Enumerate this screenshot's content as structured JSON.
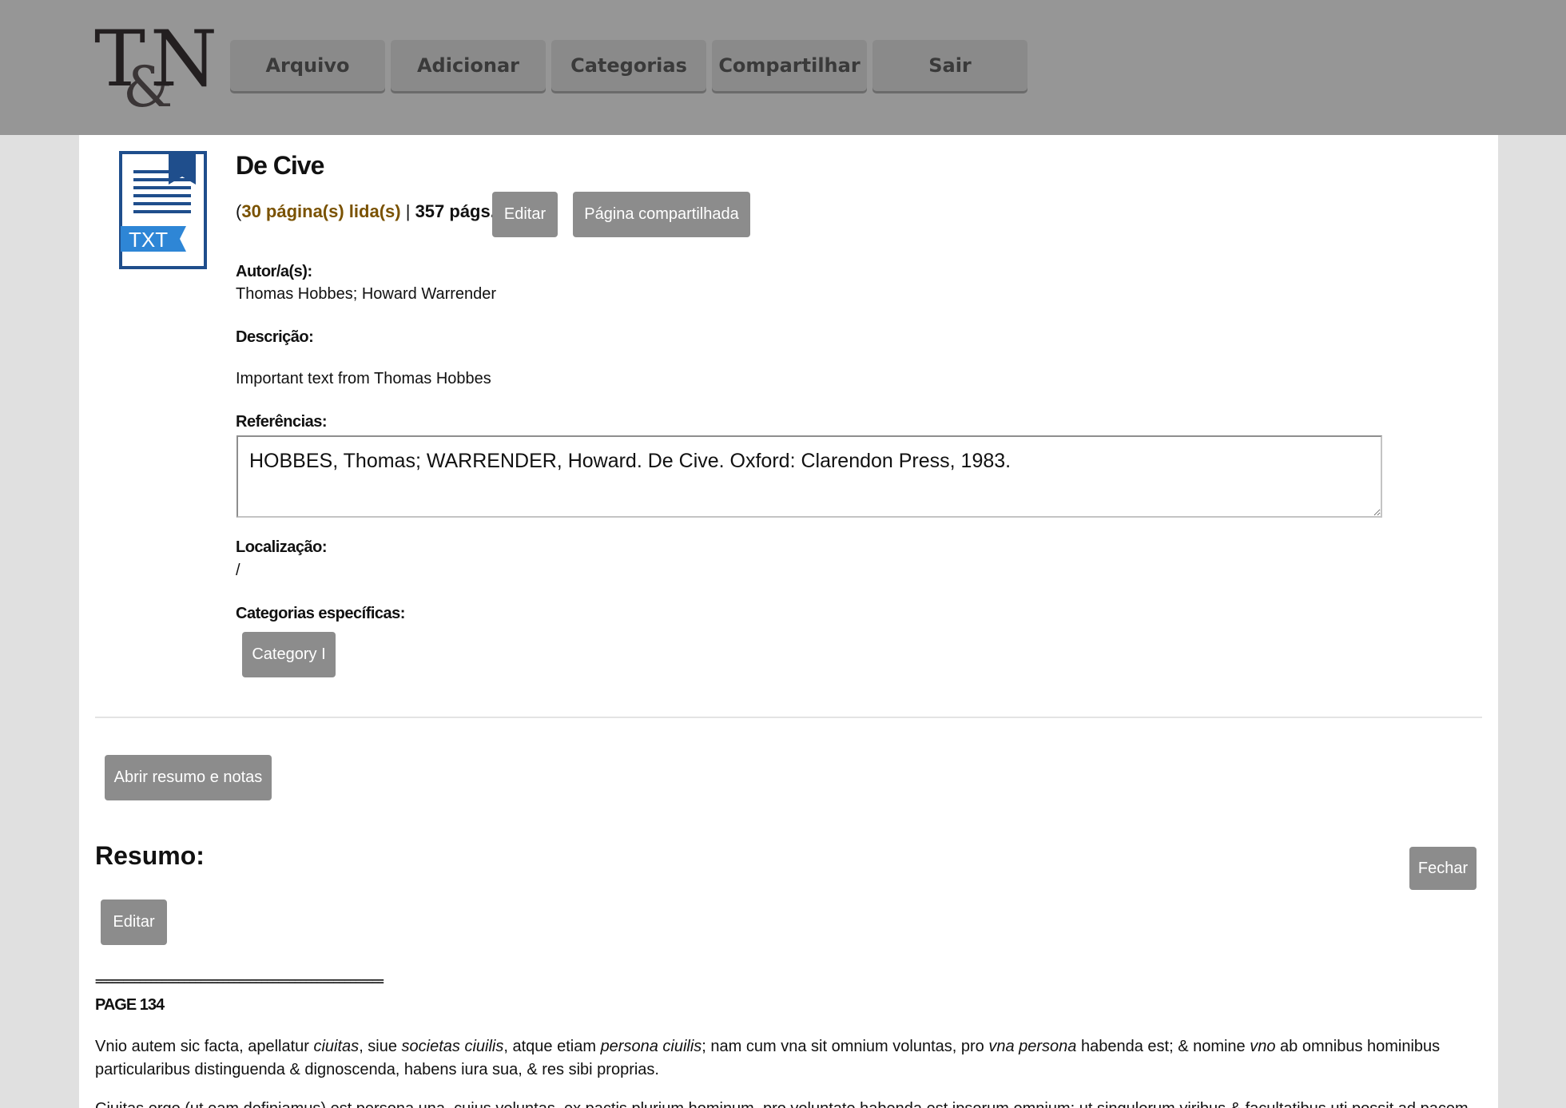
{
  "header": {
    "logo_text": "T&N",
    "nav": [
      "Arquivo",
      "Adicionar",
      "Categorias",
      "Compartilhar",
      "Sair"
    ]
  },
  "document": {
    "file_type": "TXT",
    "title": "De Cive",
    "pages_read": "30 página(s) lida(s)",
    "pages_total": "357 págs.",
    "edit_label": "Editar",
    "shared_page_label": "Página compartilhada",
    "authors_label": "Autor/a(s):",
    "authors": "Thomas Hobbes; Howard Warrender",
    "description_label": "Descrição:",
    "description": "Important text from Thomas Hobbes",
    "references_label": "Referências:",
    "references": "HOBBES, Thomas; WARRENDER, Howard. De Cive. Oxford: Clarendon Press, 1983.",
    "location_label": "Localização:",
    "location": "/",
    "categories_label": "Categorias específicas:",
    "categories": [
      "Category I"
    ]
  },
  "summary": {
    "open_button": "Abrir resumo e notas",
    "title": "Resumo:",
    "close_button": "Fechar",
    "edit_button": "Editar",
    "separator": "====================================================",
    "page_label": "PAGE 134",
    "paragraph_parts": [
      {
        "t": "Vnio autem sic facta, apellatur ",
        "i": false
      },
      {
        "t": "ciuitas",
        "i": true
      },
      {
        "t": ", siue ",
        "i": false
      },
      {
        "t": "societas ciuilis",
        "i": true
      },
      {
        "t": ", atque etiam ",
        "i": false
      },
      {
        "t": "persona ciuilis",
        "i": true
      },
      {
        "t": "; nam cum vna sit omnium voluntas, pro ",
        "i": false
      },
      {
        "t": "vna persona",
        "i": true
      },
      {
        "t": " habenda est; & nomine ",
        "i": false
      },
      {
        "t": "vno",
        "i": true
      },
      {
        "t": " ab omnibus hominibus particularibus distinguenda & dignoscenda, habens iura sua, & res sibi proprias.",
        "i": false
      }
    ],
    "next_paragraph": "Ciuitas ergo (ut eam definiamus) est persona una, cuius voluntas, ex pactis plurium hominum, pro voluntate habenda est ipsorum omnium; ut singulorum viribus & facultatibus uti possit ad pacem"
  }
}
